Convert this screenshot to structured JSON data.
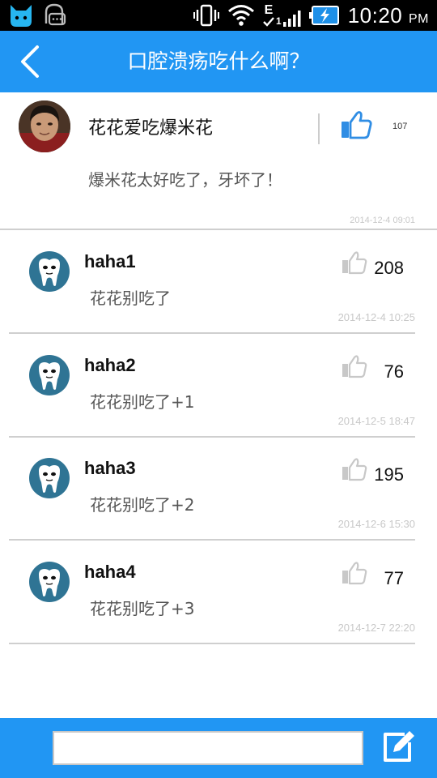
{
  "status_bar": {
    "time": "10:20",
    "ampm": "PM",
    "signal_label": "1",
    "network_letter": "E",
    "icons": [
      "cat-notification-icon",
      "chat-notification-icon",
      "vibrate-icon",
      "wifi-icon",
      "signal-icon",
      "battery-charging-icon"
    ]
  },
  "header": {
    "title": "口腔溃疡吃什么啊？",
    "back_icon": "back-arrow-icon"
  },
  "post": {
    "author": "花花爱吃爆米花",
    "text": "爆米花太好吃了，牙坏了！",
    "likes": "107",
    "time": "2014-12-4 09:01",
    "like_icon": "thumbs-up-icon"
  },
  "comments": [
    {
      "name": "haha1",
      "text": "花花别吃了",
      "likes": "208",
      "time": "2014-12-4 10:25"
    },
    {
      "name": "haha2",
      "text": "花花别吃了+1",
      "likes": "76",
      "time": "2014-12-5 18:47"
    },
    {
      "name": "haha3",
      "text": "花花别吃了+2",
      "likes": "195",
      "time": "2014-12-6 15:30"
    },
    {
      "name": "haha4",
      "text": "花花别吃了+3",
      "likes": "77",
      "time": "2014-12-7 22:20"
    }
  ],
  "footer": {
    "input_value": "",
    "edit_icon": "edit-icon"
  },
  "colors": {
    "accent": "#2196f3",
    "like_active": "#2f8de4",
    "like_inactive": "#c8c8c8",
    "avatar_bg": "#2f7494"
  }
}
